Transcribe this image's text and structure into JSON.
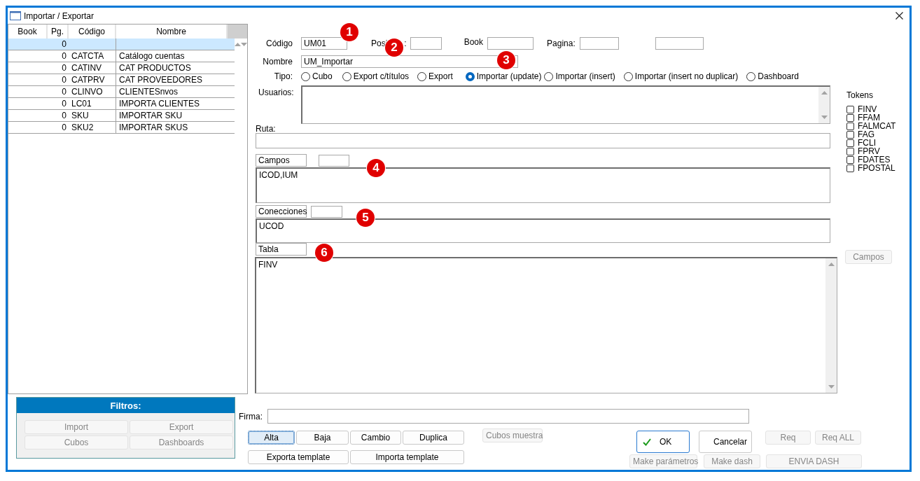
{
  "window": {
    "title": "Importar / Exportar"
  },
  "list": {
    "columns": [
      "Book",
      "Pg.",
      "Código",
      "Nombre"
    ],
    "rows": [
      {
        "pg": "0",
        "selected": true
      },
      {
        "pg": "0",
        "codigo": "CATCTA",
        "nombre": "Catálogo cuentas",
        "selected": false
      },
      {
        "pg": "0",
        "codigo": "CATINV",
        "nombre": "CAT PRODUCTOS",
        "selected": false
      },
      {
        "pg": "0",
        "codigo": "CATPRV",
        "nombre": "CAT PROVEEDORES",
        "selected": false
      },
      {
        "pg": "0",
        "codigo": "CLINVO",
        "nombre": "CLIENTESnvos",
        "selected": false
      },
      {
        "pg": "0",
        "codigo": "LC01",
        "nombre": "IMPORTA CLIENTES",
        "selected": false
      },
      {
        "pg": "0",
        "codigo": "SKU",
        "nombre": "IMPORTAR SKU",
        "selected": false
      },
      {
        "pg": "0",
        "codigo": "SKU2",
        "nombre": "IMPORTAR SKUS",
        "selected": false
      }
    ]
  },
  "filters": {
    "title": "Filtros:",
    "buttons": [
      {
        "label": "Import",
        "disabled": true
      },
      {
        "label": "Export",
        "disabled": true
      },
      {
        "label": "Cubos",
        "disabled": true
      },
      {
        "label": "Dashboards",
        "disabled": true
      }
    ]
  },
  "form": {
    "codigo": {
      "label": "Código",
      "value": "UM01"
    },
    "posicion": {
      "label_parts": [
        "Posi",
        ":"
      ]
    },
    "book": {
      "label": "Book"
    },
    "pagina": {
      "label": "Pagina:"
    },
    "nombre": {
      "label": "Nombre",
      "value": "UM_Importar"
    },
    "tipo": {
      "label": "Tipo:",
      "options": [
        {
          "label": "Cubo",
          "selected": false
        },
        {
          "label": "Export c/títulos",
          "selected": false
        },
        {
          "label": "Export",
          "selected": false
        },
        {
          "label": "Importar (update)",
          "selected": true
        },
        {
          "label": "Importar (insert)",
          "selected": false
        },
        {
          "label": "Importar (insert no duplicar)",
          "selected": false
        },
        {
          "label": "Dashboard",
          "selected": false
        }
      ]
    },
    "usuarios": {
      "label": "Usuarios:"
    },
    "ruta": {
      "label": "Ruta:"
    },
    "campos": {
      "label": "Campos",
      "value": "ICOD,IUM"
    },
    "conecciones": {
      "label": "Conecciones",
      "value": "UCOD"
    },
    "tabla": {
      "label": "Tabla",
      "value": "FINV"
    },
    "campos_button": {
      "label": "Campos",
      "disabled": true
    },
    "tokens": {
      "title": "Tokens",
      "items": [
        {
          "label": "FINV",
          "checked": false
        },
        {
          "label": "FFAM",
          "checked": false
        },
        {
          "label": "FALMCAT",
          "checked": false
        },
        {
          "label": "FAG",
          "checked": false
        },
        {
          "label": "FCLI",
          "checked": false
        },
        {
          "label": "FPRV",
          "checked": false
        },
        {
          "label": "FDATES",
          "checked": false
        },
        {
          "label": "FPOSTAL",
          "checked": false
        }
      ]
    },
    "firma": {
      "label": "Firma:"
    }
  },
  "record_buttons": [
    {
      "label": "Alta",
      "selected": true
    },
    {
      "label": "Baja",
      "selected": false
    },
    {
      "label": "Cambio",
      "selected": false
    },
    {
      "label": "Duplica",
      "selected": false
    }
  ],
  "template_buttons": [
    {
      "label": "Exporta template",
      "disabled": false
    },
    {
      "label": "Importa template",
      "disabled": false
    }
  ],
  "cubos_muestra": {
    "label": "Cubos muestra",
    "disabled": true
  },
  "ok": {
    "label": "OK"
  },
  "cancel": {
    "label": "Cancelar"
  },
  "req_buttons": [
    {
      "label": "Req",
      "disabled": true
    },
    {
      "label": "Req ALL",
      "disabled": true
    }
  ],
  "make_buttons": [
    {
      "label": "Make parámetros",
      "disabled": true
    },
    {
      "label": "Make dash",
      "disabled": true
    }
  ],
  "envia": {
    "label": "ENVIA DASH",
    "disabled": true
  },
  "callouts": [
    "1",
    "2",
    "3",
    "4",
    "5",
    "6"
  ]
}
